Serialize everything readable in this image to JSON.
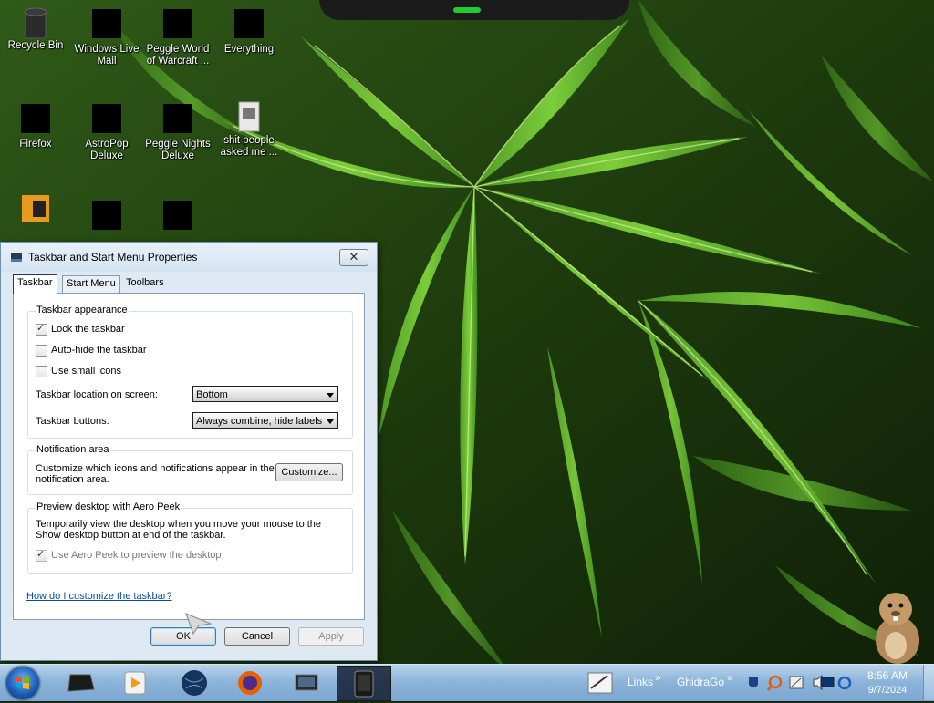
{
  "desktop": {
    "icons": [
      {
        "label": "Recycle Bin"
      },
      {
        "label": "Windows Live Mail"
      },
      {
        "label": "Peggle World of Warcraft ..."
      },
      {
        "label": "Everything"
      },
      {
        "label": "Firefox"
      },
      {
        "label": "AstroPop Deluxe"
      },
      {
        "label": "Peggle Nights Deluxe"
      },
      {
        "label": "shit people asked me ..."
      }
    ]
  },
  "dialog": {
    "title": "Taskbar and Start Menu Properties",
    "close_label": "✕",
    "tabs": [
      {
        "label": "Taskbar",
        "active": true
      },
      {
        "label": "Start Menu",
        "active": false
      },
      {
        "label": "Toolbars",
        "active": false
      }
    ],
    "appearance": {
      "heading": "Taskbar appearance",
      "lock_label": "Lock the taskbar",
      "lock_checked": true,
      "autohide_label": "Auto-hide the taskbar",
      "autohide_checked": false,
      "small_icons_label": "Use small icons",
      "small_icons_checked": false,
      "location_label": "Taskbar location on screen:",
      "location_value": "Bottom",
      "buttons_label": "Taskbar buttons:",
      "buttons_value": "Always combine, hide labels"
    },
    "notification": {
      "heading": "Notification area",
      "text": "Customize which icons and notifications appear in the notification area.",
      "button": "Customize..."
    },
    "aero_peek": {
      "heading": "Preview desktop with Aero Peek",
      "text": "Temporarily view the desktop when you move your mouse to the Show desktop button at end of the taskbar.",
      "checkbox_label": "Use Aero Peek to preview the desktop",
      "checked": true,
      "disabled": true
    },
    "help_link": "How do I customize the taskbar?",
    "buttons": {
      "ok": "OK",
      "cancel": "Cancel",
      "apply": "Apply"
    }
  },
  "taskbar": {
    "tray": {
      "links_label": "Links",
      "ghidra_label": "GhidraGo"
    },
    "clock": {
      "time": "8:56 AM",
      "date": "9/7/2024"
    }
  },
  "colors": {
    "accent": "#1d5fb6",
    "link": "#0b4aa2",
    "taskbar": "#8db5db"
  }
}
